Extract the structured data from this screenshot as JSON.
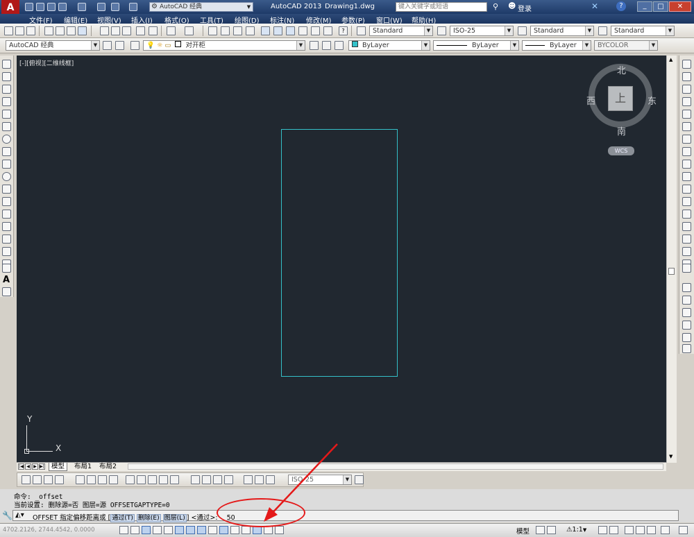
{
  "title_bar": {
    "workspace_combo": "AutoCAD 经典",
    "app_title": "AutoCAD 2013",
    "document": "Drawing1.dwg",
    "search_placeholder": "键入关键字或短语",
    "login": "登录"
  },
  "menu": {
    "items": [
      "文件(F)",
      "编辑(E)",
      "视图(V)",
      "插入(I)",
      "格式(O)",
      "工具(T)",
      "绘图(D)",
      "标注(N)",
      "修改(M)",
      "参数(P)",
      "窗口(W)",
      "帮助(H)"
    ]
  },
  "styles_toolbar": {
    "text_style": "Standard",
    "dim_style": "ISO-25",
    "table_style": "Standard",
    "multileader_style": "Standard"
  },
  "layers_toolbar": {
    "workspace": "AutoCAD 经典",
    "layer": "对开柜",
    "color": "ByLayer",
    "linetype": "ByLayer",
    "lineweight": "ByLayer",
    "plotstyle": "BYCOLOR"
  },
  "viewport": {
    "label": "[-][俯视][二维线框]",
    "compass": {
      "north": "北",
      "south": "南",
      "east": "东",
      "west": "西",
      "face": "上"
    },
    "wcs": "WCS",
    "ucs_x": "X",
    "ucs_y": "Y"
  },
  "tabs": {
    "model": "模型",
    "layout1": "布局1",
    "layout2": "布局2"
  },
  "dim_toolbar": {
    "dim_style": "ISO-25"
  },
  "command": {
    "line1": "命令:  _offset",
    "line2": "当前设置: 删除源=否  图层=源  OFFSETGAPTYPE=0",
    "prompt_prefix": "OFFSET 指定偏移距离或",
    "opt_through": "通过(T)",
    "opt_erase": "删除(E)",
    "opt_layer": "图层(L)",
    "prompt_suffix": "<通过>:",
    "value": "50"
  },
  "status_bar": {
    "coords": "4702.2126, 2744.4542, 0.0000",
    "model": "模型",
    "scale": "1:1"
  },
  "colors": {
    "canvas": "#212830",
    "rectangle": "#34c1c9",
    "annotation": "#e41919"
  }
}
